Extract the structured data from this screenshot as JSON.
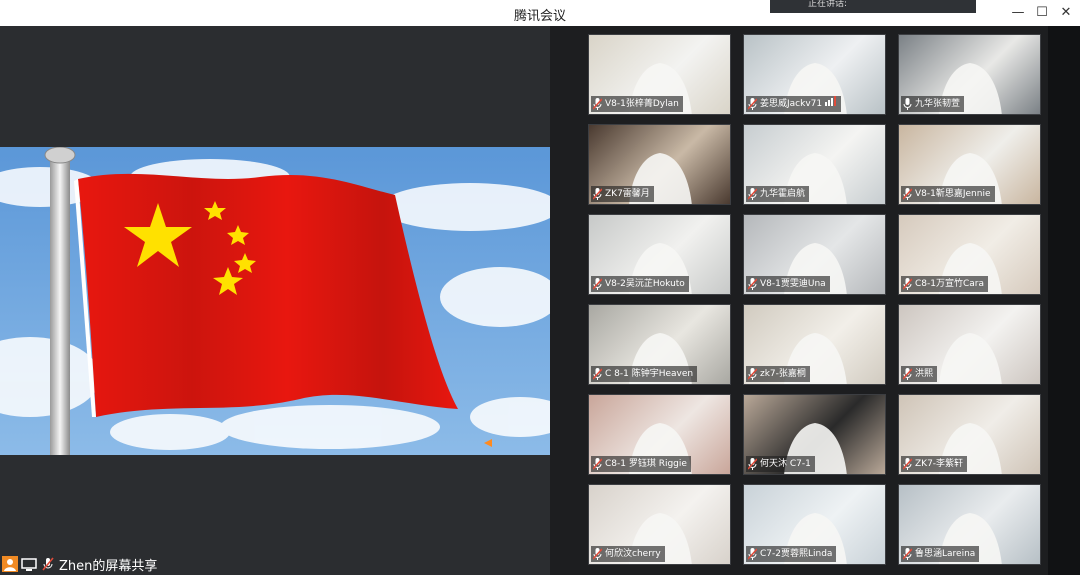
{
  "window": {
    "title": "腾讯会议",
    "toast_text": "正在讲话:"
  },
  "share": {
    "label": "Zhen的屏幕共享"
  },
  "participants": [
    {
      "name": "V8-1张梓菁Dylan",
      "muted": true
    },
    {
      "name": "姜思威Jackv71",
      "muted": true,
      "signal": true
    },
    {
      "name": "九华张韧萱",
      "muted": false
    },
    {
      "name": "ZK7雷馨月",
      "muted": true
    },
    {
      "name": "九华霍启航",
      "muted": true
    },
    {
      "name": "V8-1靳思嘉Jennie",
      "muted": true
    },
    {
      "name": "V8-2吴沅芷Hokuto",
      "muted": true
    },
    {
      "name": "V8-1贾雯迪Una",
      "muted": true
    },
    {
      "name": "C8-1万宣竹Cara",
      "muted": true
    },
    {
      "name": "C 8-1 陈钟宇Heaven",
      "muted": true
    },
    {
      "name": "zk7-张嘉桐",
      "muted": true
    },
    {
      "name": "洪熙",
      "muted": true
    },
    {
      "name": "C8-1 罗钰琪 Riggie",
      "muted": true
    },
    {
      "name": "何天沐 C7-1",
      "muted": true
    },
    {
      "name": "ZK7-李紫轩",
      "muted": true
    },
    {
      "name": "何欣汶cherry",
      "muted": true
    },
    {
      "name": "C7-2贾蓉熙Linda",
      "muted": true
    },
    {
      "name": "鲁思涵Lareina",
      "muted": true
    }
  ],
  "colors": {
    "flag_red": "#e8170f",
    "flag_star": "#ffe100",
    "sky": "#6aa3df",
    "mic_muted": "#e04b3a"
  }
}
